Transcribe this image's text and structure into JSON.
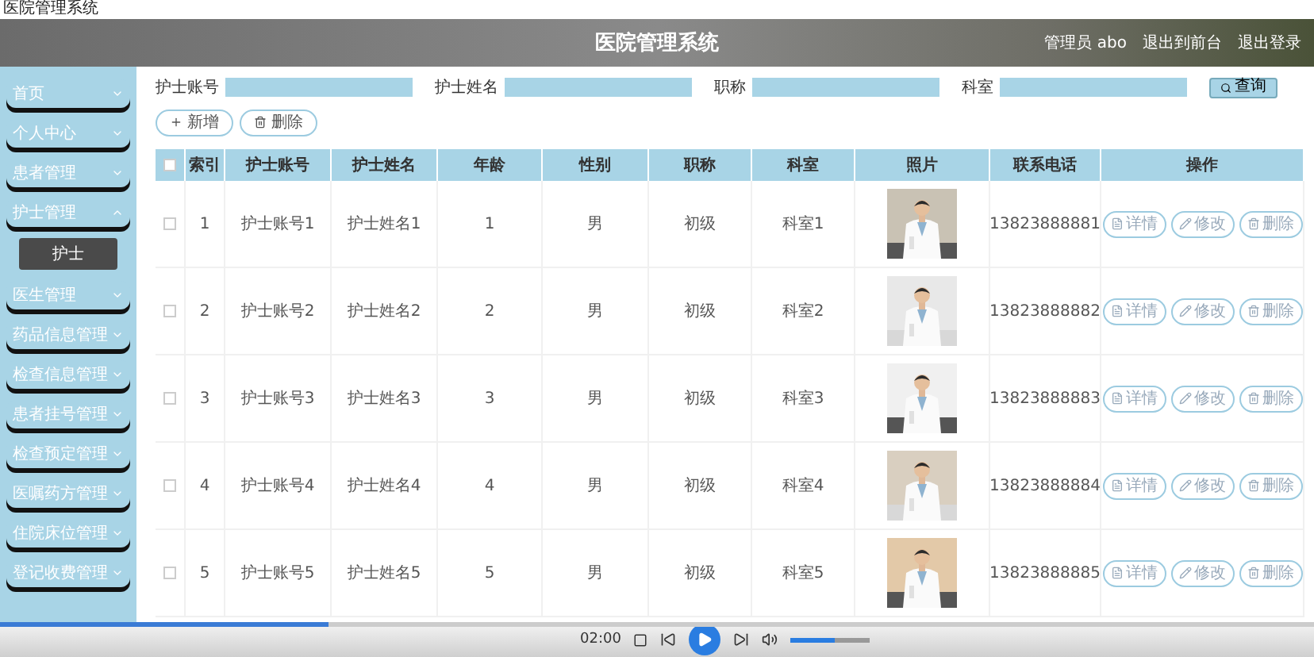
{
  "window": {
    "title": "医院管理系统"
  },
  "header": {
    "title": "医院管理系统",
    "user": "管理员 abo",
    "links": [
      "退出到前台",
      "退出登录"
    ]
  },
  "sidebar": {
    "items": [
      {
        "label": "首页",
        "expanded": false
      },
      {
        "label": "个人中心",
        "expanded": false
      },
      {
        "label": "患者管理",
        "expanded": false
      },
      {
        "label": "护士管理",
        "expanded": true,
        "children": [
          {
            "label": "护士",
            "selected": true
          }
        ]
      },
      {
        "label": "医生管理",
        "expanded": false
      },
      {
        "label": "药品信息管理",
        "expanded": false
      },
      {
        "label": "检查信息管理",
        "expanded": false
      },
      {
        "label": "患者挂号管理",
        "expanded": false
      },
      {
        "label": "检查预定管理",
        "expanded": false
      },
      {
        "label": "医嘱药方管理",
        "expanded": false
      },
      {
        "label": "住院床位管理",
        "expanded": false
      },
      {
        "label": "登记收费管理",
        "expanded": false
      }
    ]
  },
  "search": {
    "fields": [
      {
        "label": "护士账号"
      },
      {
        "label": "护士姓名"
      },
      {
        "label": "职称"
      },
      {
        "label": "科室"
      }
    ],
    "button": "查询"
  },
  "toolbar": [
    {
      "kind": "add",
      "label": "新增"
    },
    {
      "kind": "delete",
      "label": "删除"
    }
  ],
  "table": {
    "all_checked": false,
    "columns": [
      "索引",
      "护士账号",
      "护士姓名",
      "年龄",
      "性别",
      "职称",
      "科室",
      "照片",
      "联系电话",
      "操作"
    ],
    "rows": [
      {
        "checked": false,
        "cells": [
          "1",
          "护士账号1",
          "护士姓名1",
          "1",
          "男",
          "初级",
          "科室1"
        ],
        "photo": {
          "kind": "picture"
        },
        "phone": "13823888881",
        "actions": [
          {
            "kind": "detail",
            "label": "详情"
          },
          {
            "kind": "edit",
            "label": "修改"
          },
          {
            "kind": "delete",
            "label": "删除"
          }
        ]
      },
      {
        "checked": false,
        "cells": [
          "2",
          "护士账号2",
          "护士姓名2",
          "2",
          "男",
          "初级",
          "科室2"
        ],
        "photo": {
          "kind": "picture"
        },
        "phone": "13823888882",
        "actions": [
          {
            "kind": "detail",
            "label": "详情"
          },
          {
            "kind": "edit",
            "label": "修改"
          },
          {
            "kind": "delete",
            "label": "删除"
          }
        ]
      },
      {
        "checked": false,
        "cells": [
          "3",
          "护士账号3",
          "护士姓名3",
          "3",
          "男",
          "初级",
          "科室3"
        ],
        "photo": {
          "kind": "picture"
        },
        "phone": "13823888883",
        "actions": [
          {
            "kind": "detail",
            "label": "详情"
          },
          {
            "kind": "edit",
            "label": "修改"
          },
          {
            "kind": "delete",
            "label": "删除"
          }
        ]
      },
      {
        "checked": false,
        "cells": [
          "4",
          "护士账号4",
          "护士姓名4",
          "4",
          "男",
          "初级",
          "科室4"
        ],
        "photo": {
          "kind": "picture"
        },
        "phone": "13823888884",
        "actions": [
          {
            "kind": "detail",
            "label": "详情"
          },
          {
            "kind": "edit",
            "label": "修改"
          },
          {
            "kind": "delete",
            "label": "删除"
          }
        ]
      },
      {
        "checked": false,
        "cells": [
          "5",
          "护士账号5",
          "护士姓名5",
          "5",
          "男",
          "初级",
          "科室5"
        ],
        "photo": {
          "kind": "picture"
        },
        "phone": "13823888885",
        "actions": [
          {
            "kind": "detail",
            "label": "详情"
          },
          {
            "kind": "edit",
            "label": "修改"
          },
          {
            "kind": "delete",
            "label": "删除"
          }
        ]
      }
    ]
  },
  "player": {
    "time": "02:00",
    "progress": {
      "level": 0.25
    },
    "volume": {
      "level": 0.55
    }
  }
}
